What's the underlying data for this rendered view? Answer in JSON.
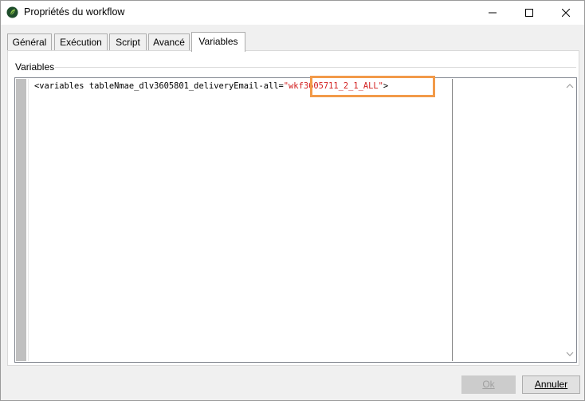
{
  "window": {
    "title": "Propriétés du workflow",
    "icon": "workflow-leaf-icon"
  },
  "tabs": [
    {
      "label": "Général"
    },
    {
      "label": "Exécution"
    },
    {
      "label": "Script"
    },
    {
      "label": "Avancé"
    },
    {
      "label": "Variables",
      "active": true
    }
  ],
  "variables": {
    "group_label": "Variables",
    "code_prefix": "<variables tableNmae_dlv3605801_deliveryEmail-all=",
    "code_value": "\"wkf3605711_2_1_ALL\"",
    "code_suffix": ">"
  },
  "buttons": {
    "ok_label": "Ok",
    "cancel_label": "Annuler"
  },
  "colors": {
    "highlight": "#f29a49",
    "string_value": "#d21e1e",
    "gutter": "#c0c0c0"
  }
}
